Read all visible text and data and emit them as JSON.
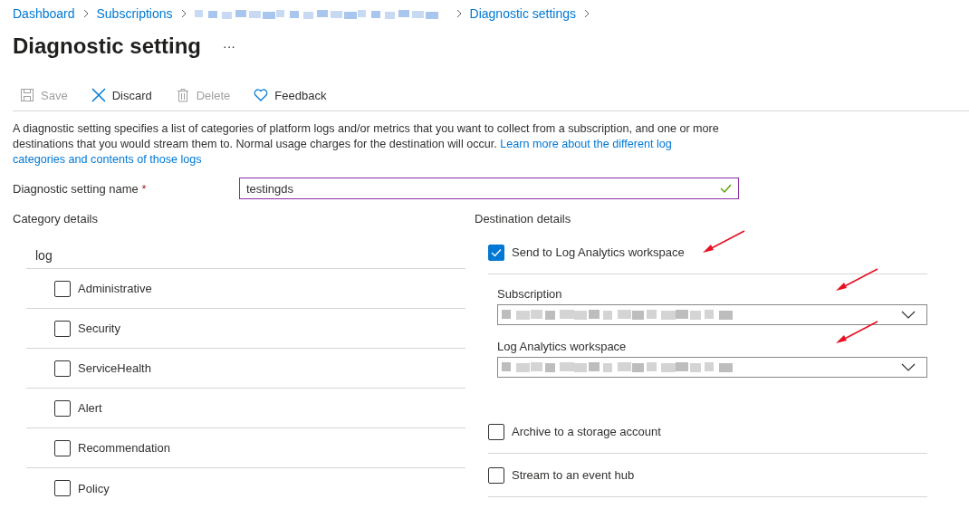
{
  "breadcrumb": [
    {
      "kind": "link",
      "text": "Dashboard"
    },
    {
      "kind": "link",
      "text": "Subscriptions"
    },
    {
      "kind": "redacted"
    },
    {
      "kind": "link",
      "text": "Diagnostic settings"
    }
  ],
  "title": "Diagnostic setting",
  "more": "···",
  "toolbar": [
    {
      "kind": "save",
      "label": "Save",
      "disabled": true
    },
    {
      "kind": "discard",
      "label": "Discard",
      "disabled": false
    },
    {
      "kind": "delete",
      "label": "Delete",
      "disabled": true
    },
    {
      "kind": "feedback",
      "label": "Feedback",
      "disabled": false
    }
  ],
  "description": {
    "text": "A diagnostic setting specifies a list of categories of platform logs and/or metrics that you want to collect from a subscription, and one or more destinations that you would stream them to. Normal usage charges for the destination will occur. ",
    "links": [
      "Learn more about the different log",
      "categories and contents of those logs"
    ]
  },
  "name_field": {
    "label": "Diagnostic setting name",
    "required_mark": "*",
    "value": "testingds",
    "valid": true
  },
  "categories": {
    "heading": "Category details",
    "group": "log",
    "items": [
      {
        "label": "Administrative",
        "checked": false
      },
      {
        "label": "Security",
        "checked": false
      },
      {
        "label": "ServiceHealth",
        "checked": false
      },
      {
        "label": "Alert",
        "checked": false
      },
      {
        "label": "Recommendation",
        "checked": false
      },
      {
        "label": "Policy",
        "checked": false
      }
    ]
  },
  "destinations": {
    "heading": "Destination details",
    "items": [
      {
        "label": "Send to Log Analytics workspace",
        "checked": true,
        "annotated": true,
        "fields": [
          {
            "label": "Subscription",
            "redacted": true,
            "annotated": true
          },
          {
            "label": "Log Analytics workspace",
            "redacted": true,
            "annotated": true
          }
        ]
      },
      {
        "label": "Archive to a storage account",
        "checked": false,
        "annotated": false
      },
      {
        "label": "Stream to an event hub",
        "checked": false,
        "annotated": false
      }
    ]
  }
}
